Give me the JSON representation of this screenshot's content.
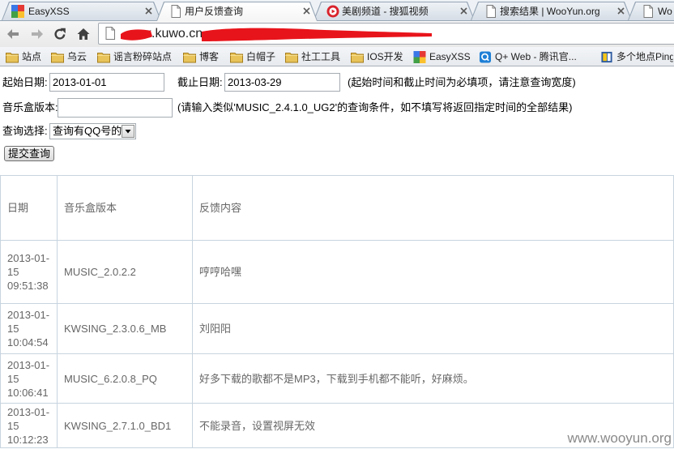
{
  "browser": {
    "tabs": [
      {
        "title": "EasyXSS",
        "icon": "easyxss-favicon-icon",
        "active": false
      },
      {
        "title": "用户反馈查询",
        "icon": "page-icon",
        "active": true
      },
      {
        "title": "美剧频道 - 搜狐视频",
        "icon": "sohu-video-icon",
        "active": false
      },
      {
        "title": "搜索结果 | WooYun.org",
        "icon": "page-icon",
        "active": false
      },
      {
        "title": "Wo",
        "icon": "page-icon",
        "active": false
      }
    ],
    "nav_icons": [
      "back-arrow-icon",
      "forward-arrow-icon",
      "reload-icon",
      "home-icon"
    ],
    "address": {
      "url_visible": "x.kuwo.cn"
    },
    "bookmarks": [
      {
        "label": "站点",
        "icon": "folder-icon"
      },
      {
        "label": "乌云",
        "icon": "folder-icon"
      },
      {
        "label": "谣言粉碎站点",
        "icon": "folder-icon"
      },
      {
        "label": "博客",
        "icon": "folder-icon"
      },
      {
        "label": "白帽子",
        "icon": "folder-icon"
      },
      {
        "label": "社工工具",
        "icon": "folder-icon"
      },
      {
        "label": "IOS开发",
        "icon": "folder-icon"
      },
      {
        "label": "EasyXSS",
        "icon": "easyxss-favicon-icon"
      },
      {
        "label": "Q+ Web - 腾讯官...",
        "icon": "qq-plus-icon"
      },
      {
        "label": "多个地点Ping",
        "icon": "ping-site-icon"
      }
    ]
  },
  "colors": {
    "redaction": "#e8141b"
  },
  "form": {
    "start_date_label": "起始日期:",
    "start_date_value": "2013-01-01",
    "end_date_label": "截止日期:",
    "end_date_value": "2013-03-29",
    "date_hint": "(起始时间和截止时间为必填项，请注意查询宽度)",
    "version_label": "音乐盒版本:",
    "version_value": "",
    "version_hint": "(请输入类似'MUSIC_2.4.1.0_UG2'的查询条件，如不填写将返回指定时间的全部结果)",
    "query_label": "查询选择:",
    "query_selected": "查询有QQ号的",
    "submit_label": "提交查询"
  },
  "table": {
    "headers": [
      "日期",
      "音乐盒版本",
      "反馈内容"
    ],
    "rows": [
      {
        "date": "2013-01-15 09:51:38",
        "version": "MUSIC_2.0.2.2",
        "content": "哼哼哈嘿"
      },
      {
        "date": "2013-01-15 10:04:54",
        "version": "KWSING_2.3.0.6_MB",
        "content": "刘阳阳"
      },
      {
        "date": "2013-01-15 10:06:41",
        "version": "MUSIC_6.2.0.8_PQ",
        "content": "好多下载的歌都不是MP3，下载到手机都不能听，好麻烦。"
      },
      {
        "date": "2013-01-15 10:12:23",
        "version": "KWSING_2.7.1.0_BD1",
        "content": "不能录音，设置视屏无效"
      }
    ]
  },
  "watermark": "www.wooyun.org"
}
